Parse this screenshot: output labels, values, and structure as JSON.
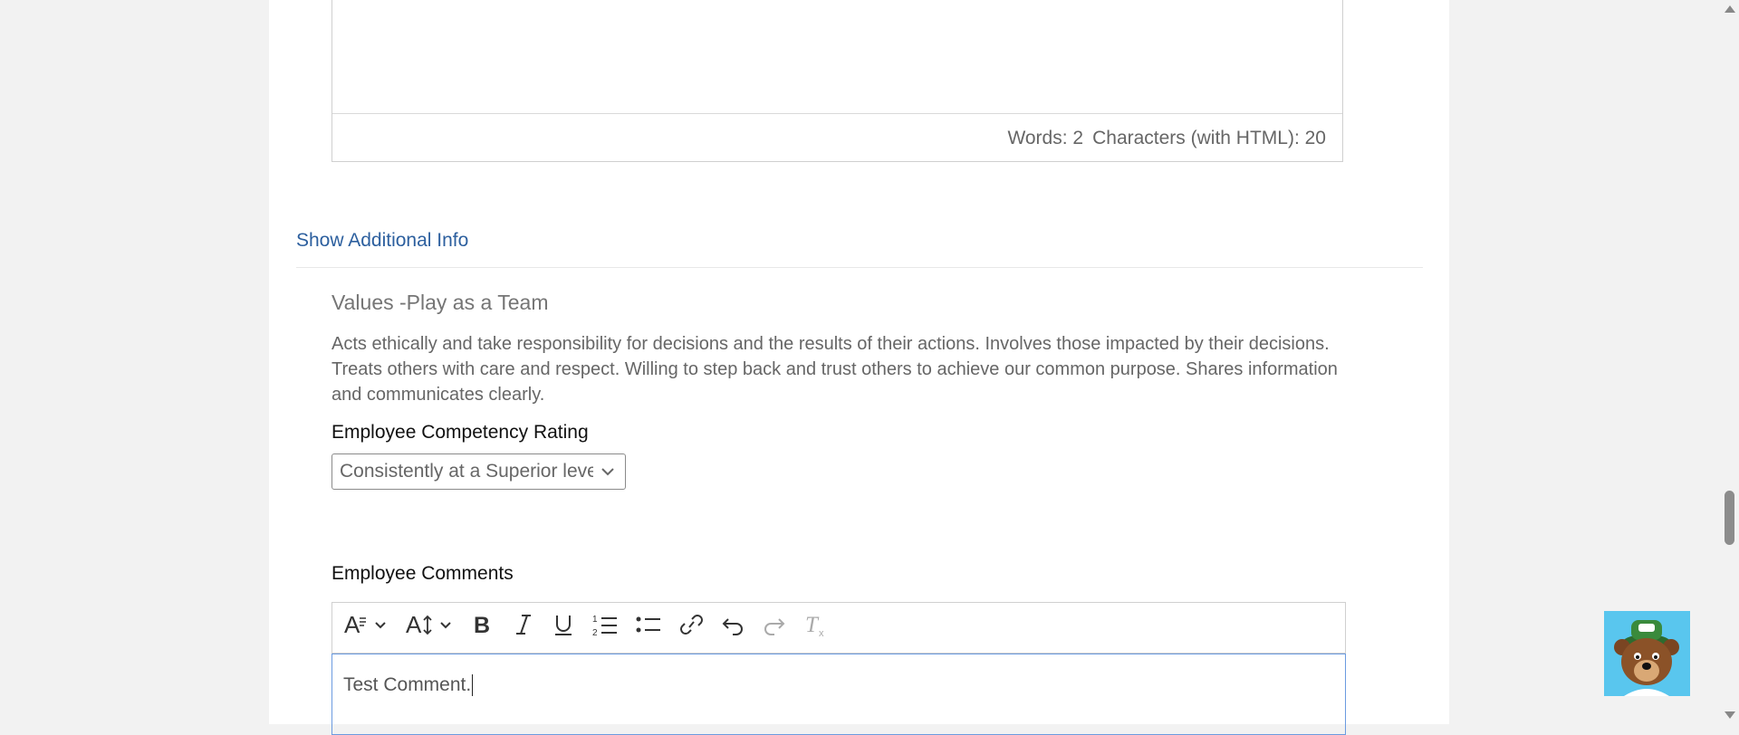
{
  "top_editor": {
    "words_label": "Words: 2",
    "chars_label": "Characters (with HTML): 20"
  },
  "additional_info_link": "Show Additional Info",
  "section": {
    "title": "Values -Play as a Team",
    "description": "Acts ethically and take responsibility for decisions and the results of their actions. Involves those impacted by their decisions. Treats others with care and respect. Willing to step back and trust others to achieve our common purpose. Shares information and communicates clearly."
  },
  "rating": {
    "label": "Employee Competency Rating",
    "selected_value": "Consistently at a Superior level"
  },
  "comments": {
    "label": "Employee Comments",
    "value": "Test Comment."
  },
  "toolbar": {
    "icons": [
      "font-style-icon",
      "font-size-icon",
      "bold-icon",
      "italic-icon",
      "underline-icon",
      "ordered-list-icon",
      "bullet-list-icon",
      "link-icon",
      "undo-icon",
      "redo-icon",
      "clear-format-icon"
    ]
  },
  "colors": {
    "link": "#2c5f9e",
    "focus_border": "#6b9be0",
    "mascot_bg": "#59c6ee"
  }
}
